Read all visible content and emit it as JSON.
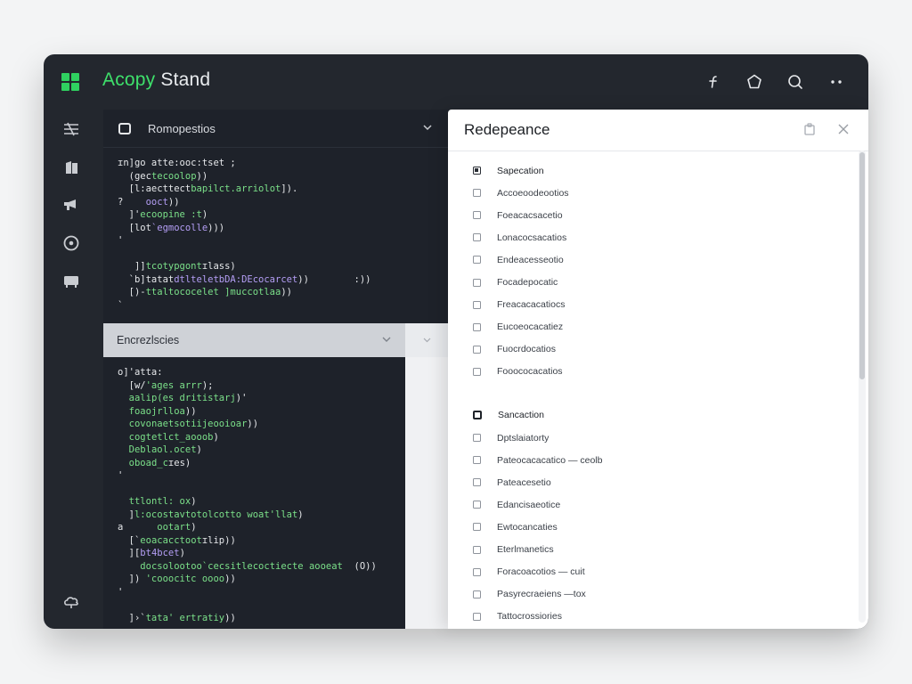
{
  "app": {
    "title_accent": "Acopy",
    "title_rest": "Stand"
  },
  "topbar": {
    "icons": [
      "function-icon",
      "pentagon-icon",
      "search-icon",
      "more-icon"
    ]
  },
  "sidebar": {
    "icons": [
      "filter-icon",
      "book-icon",
      "megaphone-icon",
      "target-icon",
      "terminal-icon",
      "cloud-icon"
    ]
  },
  "colors": {
    "accent": "#3ee06b",
    "code_white": "#e6e8eb",
    "code_green": "#7be089",
    "code_purple": "#b49ef5"
  },
  "panel1": {
    "title": "Romopestios",
    "lines": [
      [
        [
          "w",
          "ɪn]go atte:ooc:tset ;"
        ]
      ],
      [
        [
          "w",
          "  (gec"
        ],
        [
          "g",
          "tecoolop"
        ],
        [
          "w",
          "))"
        ]
      ],
      [
        [
          "w",
          "  [l:aecttect"
        ],
        [
          "g",
          "bapilct.arriolot"
        ],
        [
          "w",
          "])."
        ]
      ],
      [
        [
          "w",
          "?    "
        ],
        [
          "p",
          "ooct"
        ],
        [
          "w",
          "))"
        ]
      ],
      [
        [
          "w",
          "  ]'"
        ],
        [
          "g",
          "ecoopine :t"
        ],
        [
          "w",
          ")"
        ]
      ],
      [
        [
          "w",
          "  [lot"
        ],
        [
          "p",
          "`egmocolle"
        ],
        [
          "w",
          ")))"
        ]
      ],
      [
        [
          "w",
          "'"
        ]
      ],
      [
        [
          "w",
          ""
        ]
      ],
      [
        [
          "w",
          "   ]]"
        ],
        [
          "g",
          "tcotypgont"
        ],
        [
          "w",
          "ɪlass)"
        ]
      ],
      [
        [
          "w",
          "  `b]tatat"
        ],
        [
          "p",
          "dtlteletbDA:DEcocarcet"
        ],
        [
          "w",
          "))        :))"
        ]
      ],
      [
        [
          "w",
          "  [)-"
        ],
        [
          "g",
          "ttaltococelet ]muccotlaa"
        ],
        [
          "w",
          "))"
        ]
      ],
      [
        [
          "w",
          "`"
        ]
      ]
    ]
  },
  "panel2": {
    "title": "Encrezlscies",
    "lines": [
      [
        [
          "w",
          "o]'atta:"
        ]
      ],
      [
        [
          "w",
          "  [w/"
        ],
        [
          "g",
          "'ages arrr"
        ],
        [
          "w",
          ");"
        ]
      ],
      [
        [
          "w",
          "  "
        ],
        [
          "g",
          "aalip(es dritistarj"
        ],
        [
          "w",
          ")'"
        ]
      ],
      [
        [
          "w",
          "  "
        ],
        [
          "g",
          "foaojrlloa"
        ],
        [
          "w",
          "))"
        ]
      ],
      [
        [
          "w",
          "  "
        ],
        [
          "g",
          "covonaetsotiijeooioar"
        ],
        [
          "w",
          "))"
        ]
      ],
      [
        [
          "w",
          "  "
        ],
        [
          "g",
          "cogtetlct_aooob"
        ],
        [
          "w",
          ")"
        ]
      ],
      [
        [
          "w",
          "  "
        ],
        [
          "g",
          "Deblaol.ocet"
        ],
        [
          "w",
          ")"
        ]
      ],
      [
        [
          "w",
          "  "
        ],
        [
          "g",
          "oboad_c"
        ],
        [
          "w",
          "ɪes)"
        ]
      ],
      [
        [
          "w",
          "'"
        ]
      ],
      [
        [
          "w",
          ""
        ]
      ],
      [
        [
          "w",
          "  "
        ],
        [
          "g",
          "ttlontl: ox"
        ],
        [
          "w",
          ")"
        ]
      ],
      [
        [
          "w",
          "  ]"
        ],
        [
          "g",
          "l:ocostavtotolcotto woat'llat"
        ],
        [
          "w",
          ")"
        ]
      ],
      [
        [
          "w",
          "a      "
        ],
        [
          "g",
          "ootart"
        ],
        [
          "w",
          ")"
        ]
      ],
      [
        [
          "w",
          "  [`"
        ],
        [
          "g",
          "eoacacctoot"
        ],
        [
          "w",
          "ɪlip))"
        ]
      ],
      [
        [
          "w",
          "  ]["
        ],
        [
          "p",
          "bt4bcet"
        ],
        [
          "w",
          ")"
        ]
      ],
      [
        [
          "w",
          "    "
        ],
        [
          "g",
          "docsolootoo`cecsitlecoctiecte aooeat"
        ],
        [
          "w",
          "  (O))"
        ]
      ],
      [
        [
          "w",
          "  ]) "
        ],
        [
          "g",
          "'cooocitc oooo"
        ],
        [
          "w",
          "))"
        ]
      ],
      [
        [
          "w",
          "'"
        ]
      ],
      [
        [
          "w",
          ""
        ]
      ],
      [
        [
          "w",
          "  ]›`"
        ],
        [
          "g",
          "tata' ertratiy"
        ],
        [
          "w",
          "))"
        ]
      ]
    ]
  },
  "right_panel": {
    "title": "Redepeance",
    "section1": {
      "header": "Sapecation",
      "items": [
        "Accoeoodeootios",
        "Foeacacsacetio",
        "Lonacocsacatios",
        "Endeacesseotio",
        "Focadepocatic",
        "Freacacacatiocs",
        "Eucoeocacatiez",
        "Fuocrdocatios",
        "Fooococacatios"
      ]
    },
    "section2": {
      "header": "Sancaction",
      "items": [
        "Dptslaiatorty",
        "Pateocacacatico — ceolb",
        "Pateacesetio",
        "Edancisaeotice",
        "Ewtocancaties",
        "Eterlmanetics",
        "Foracoacotios — cuit",
        "Pasyrecraeiens —tox",
        "Tattocrossiories"
      ]
    }
  }
}
